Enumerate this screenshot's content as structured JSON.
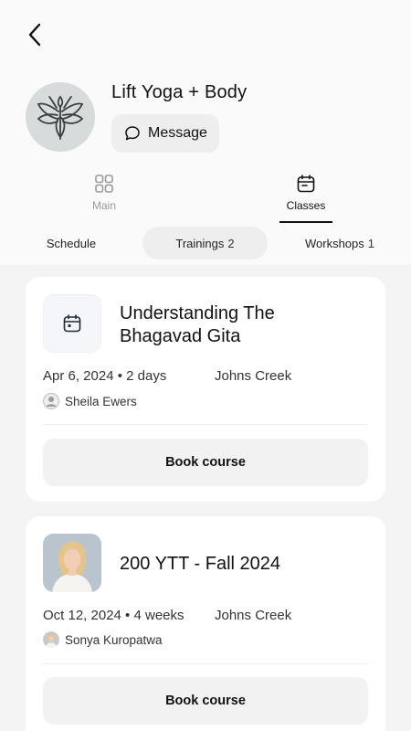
{
  "header": {
    "back_icon": "chevron-left-icon",
    "studio_name": "Lift Yoga + Body",
    "message_label": "Message"
  },
  "nav": {
    "main_label": "Main",
    "classes_label": "Classes"
  },
  "subtabs": {
    "schedule_label": "Schedule",
    "trainings_label": "Trainings",
    "trainings_count": "2",
    "workshops_label": "Workshops",
    "workshops_count": "1"
  },
  "trainings": [
    {
      "title_line1": "Understanding The",
      "title_line2": "Bhagavad Gita",
      "date": "Apr 6, 2024 • 2 days",
      "location": "Johns Creek",
      "instructor": "Sheila Ewers",
      "book_label": "Book course"
    },
    {
      "title_line1": "200 YTT - Fall 2024",
      "date": "Oct 12, 2024 • 4 weeks",
      "location": "Johns Creek",
      "instructor": "Sonya Kuropatwa",
      "book_label": "Book course"
    }
  ],
  "colors": {
    "accent": "#111111",
    "muted": "#9a9a9a",
    "list_bg": "#f4f4f4",
    "button_bg": "#f2f2f2"
  }
}
